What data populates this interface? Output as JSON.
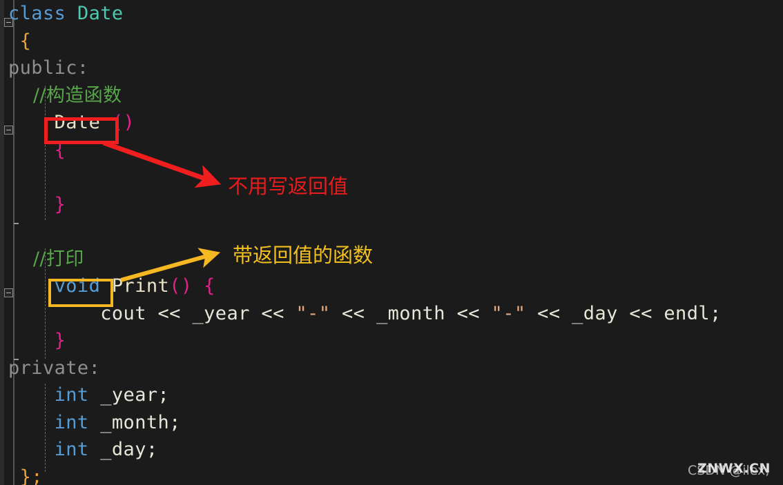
{
  "editor": {
    "language": "cpp",
    "background": "#1b1b1b",
    "gutter_color": "#2b2b2b",
    "code_lines": [
      {
        "id": "line-class-date",
        "tokens": [
          {
            "text": "class ",
            "cls": "kw"
          },
          {
            "text": "Date",
            "cls": "type"
          }
        ]
      },
      {
        "id": "line-open-brace",
        "tokens": [
          {
            "text": " {",
            "cls": "brace-o"
          }
        ]
      },
      {
        "id": "line-public",
        "tokens": [
          {
            "text": "public:",
            "cls": "access"
          }
        ]
      },
      {
        "id": "line-comment-ctor",
        "tokens": [
          {
            "text": "    //构造函数",
            "cls": "comment cjk"
          }
        ]
      },
      {
        "id": "line-ctor-decl",
        "tokens": [
          {
            "text": "    ",
            "cls": "plain"
          },
          {
            "text": "Date",
            "cls": "ident"
          },
          {
            "text": " ()",
            "cls": "paren"
          }
        ]
      },
      {
        "id": "line-ctor-open",
        "tokens": [
          {
            "text": "    {",
            "cls": "brace-p"
          }
        ]
      },
      {
        "id": "line-ctor-body",
        "tokens": [
          {
            "text": "",
            "cls": "plain"
          }
        ]
      },
      {
        "id": "line-ctor-close",
        "tokens": [
          {
            "text": "    }",
            "cls": "brace-p"
          }
        ]
      },
      {
        "id": "line-blank-1",
        "tokens": [
          {
            "text": "",
            "cls": "plain"
          }
        ]
      },
      {
        "id": "line-comment-print",
        "tokens": [
          {
            "text": "    //打印",
            "cls": "comment cjk"
          }
        ]
      },
      {
        "id": "line-print-decl",
        "tokens": [
          {
            "text": "    ",
            "cls": "plain"
          },
          {
            "text": "void",
            "cls": "kw"
          },
          {
            "text": " ",
            "cls": "plain"
          },
          {
            "text": "Print",
            "cls": "fn"
          },
          {
            "text": "()",
            "cls": "paren"
          },
          {
            "text": " {",
            "cls": "brace-p"
          }
        ]
      },
      {
        "id": "line-cout",
        "tokens": [
          {
            "text": "        cout << _year << ",
            "cls": "plain"
          },
          {
            "text": "\"-\"",
            "cls": "str"
          },
          {
            "text": " << _month << ",
            "cls": "plain"
          },
          {
            "text": "\"-\"",
            "cls": "str"
          },
          {
            "text": " << _day << endl;",
            "cls": "plain"
          }
        ]
      },
      {
        "id": "line-print-close",
        "tokens": [
          {
            "text": "    }",
            "cls": "brace-p"
          }
        ]
      },
      {
        "id": "line-private",
        "tokens": [
          {
            "text": "private:",
            "cls": "access"
          }
        ]
      },
      {
        "id": "line-field-year",
        "tokens": [
          {
            "text": "    ",
            "cls": "plain"
          },
          {
            "text": "int",
            "cls": "kw"
          },
          {
            "text": " _year;",
            "cls": "plain"
          }
        ]
      },
      {
        "id": "line-field-month",
        "tokens": [
          {
            "text": "    ",
            "cls": "plain"
          },
          {
            "text": "int",
            "cls": "kw"
          },
          {
            "text": " _month;",
            "cls": "plain"
          }
        ]
      },
      {
        "id": "line-field-day",
        "tokens": [
          {
            "text": "    ",
            "cls": "plain"
          },
          {
            "text": "int",
            "cls": "kw"
          },
          {
            "text": " _day;",
            "cls": "plain"
          }
        ]
      },
      {
        "id": "line-class-close",
        "tokens": [
          {
            "text": " };",
            "cls": "brace-o"
          }
        ]
      }
    ]
  },
  "annotations": {
    "constructor": {
      "label": "不用写返回值",
      "color": "#e81c1c",
      "highlight_target": "Date",
      "arrow_color": "#f01e1e"
    },
    "print": {
      "label": "带返回值的函数",
      "color": "#f2c01e",
      "highlight_target": "void",
      "arrow_color": "#f5b722"
    }
  },
  "watermark": {
    "primary": "CSDN @ilex;",
    "overlay": "ZNWX.CN"
  }
}
